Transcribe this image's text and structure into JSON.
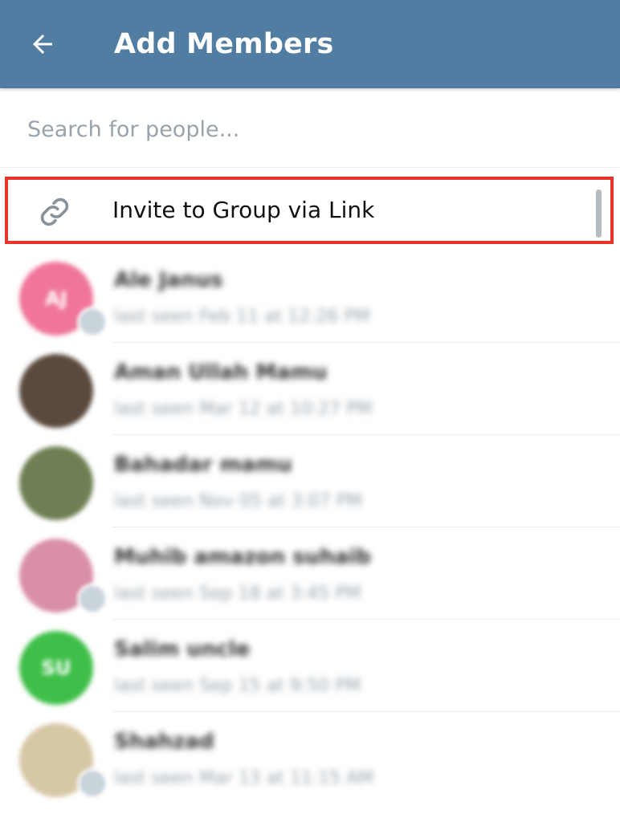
{
  "header": {
    "title": "Add Members",
    "back_icon": "arrow-left-icon",
    "background": "#517da2"
  },
  "search": {
    "placeholder": "Search for people..."
  },
  "invite": {
    "label": "Invite to Group via Link",
    "icon": "link-icon",
    "highlight_color": "#e8352b"
  },
  "contacts": [
    {
      "name": "Ale Janus",
      "status": "last seen Feb 11 at 12:26 PM",
      "avatar_text": "AJ",
      "avatar_color": "#f0759a",
      "badge": true
    },
    {
      "name": "Aman Ullah Mamu",
      "status": "last seen Mar 12 at 10:27 PM",
      "avatar_text": "",
      "avatar_color": "#5a4a3e",
      "badge": false
    },
    {
      "name": "Bahadar mamu",
      "status": "last seen Nov 05 at 3:07 PM",
      "avatar_text": "",
      "avatar_color": "#6e7f53",
      "badge": false
    },
    {
      "name": "Muhib amazon suhaib",
      "status": "last seen Sep 18 at 3:45 PM",
      "avatar_text": "",
      "avatar_color": "#d98fa6",
      "badge": true
    },
    {
      "name": "Salim uncle",
      "status": "last seen Sep 15 at 9:50 PM",
      "avatar_text": "SU",
      "avatar_color": "#3fbf49",
      "badge": false
    },
    {
      "name": "Shahzad",
      "status": "last seen Mar 13 at 11:15 AM",
      "avatar_text": "",
      "avatar_color": "#d6c7a5",
      "badge": true
    }
  ]
}
